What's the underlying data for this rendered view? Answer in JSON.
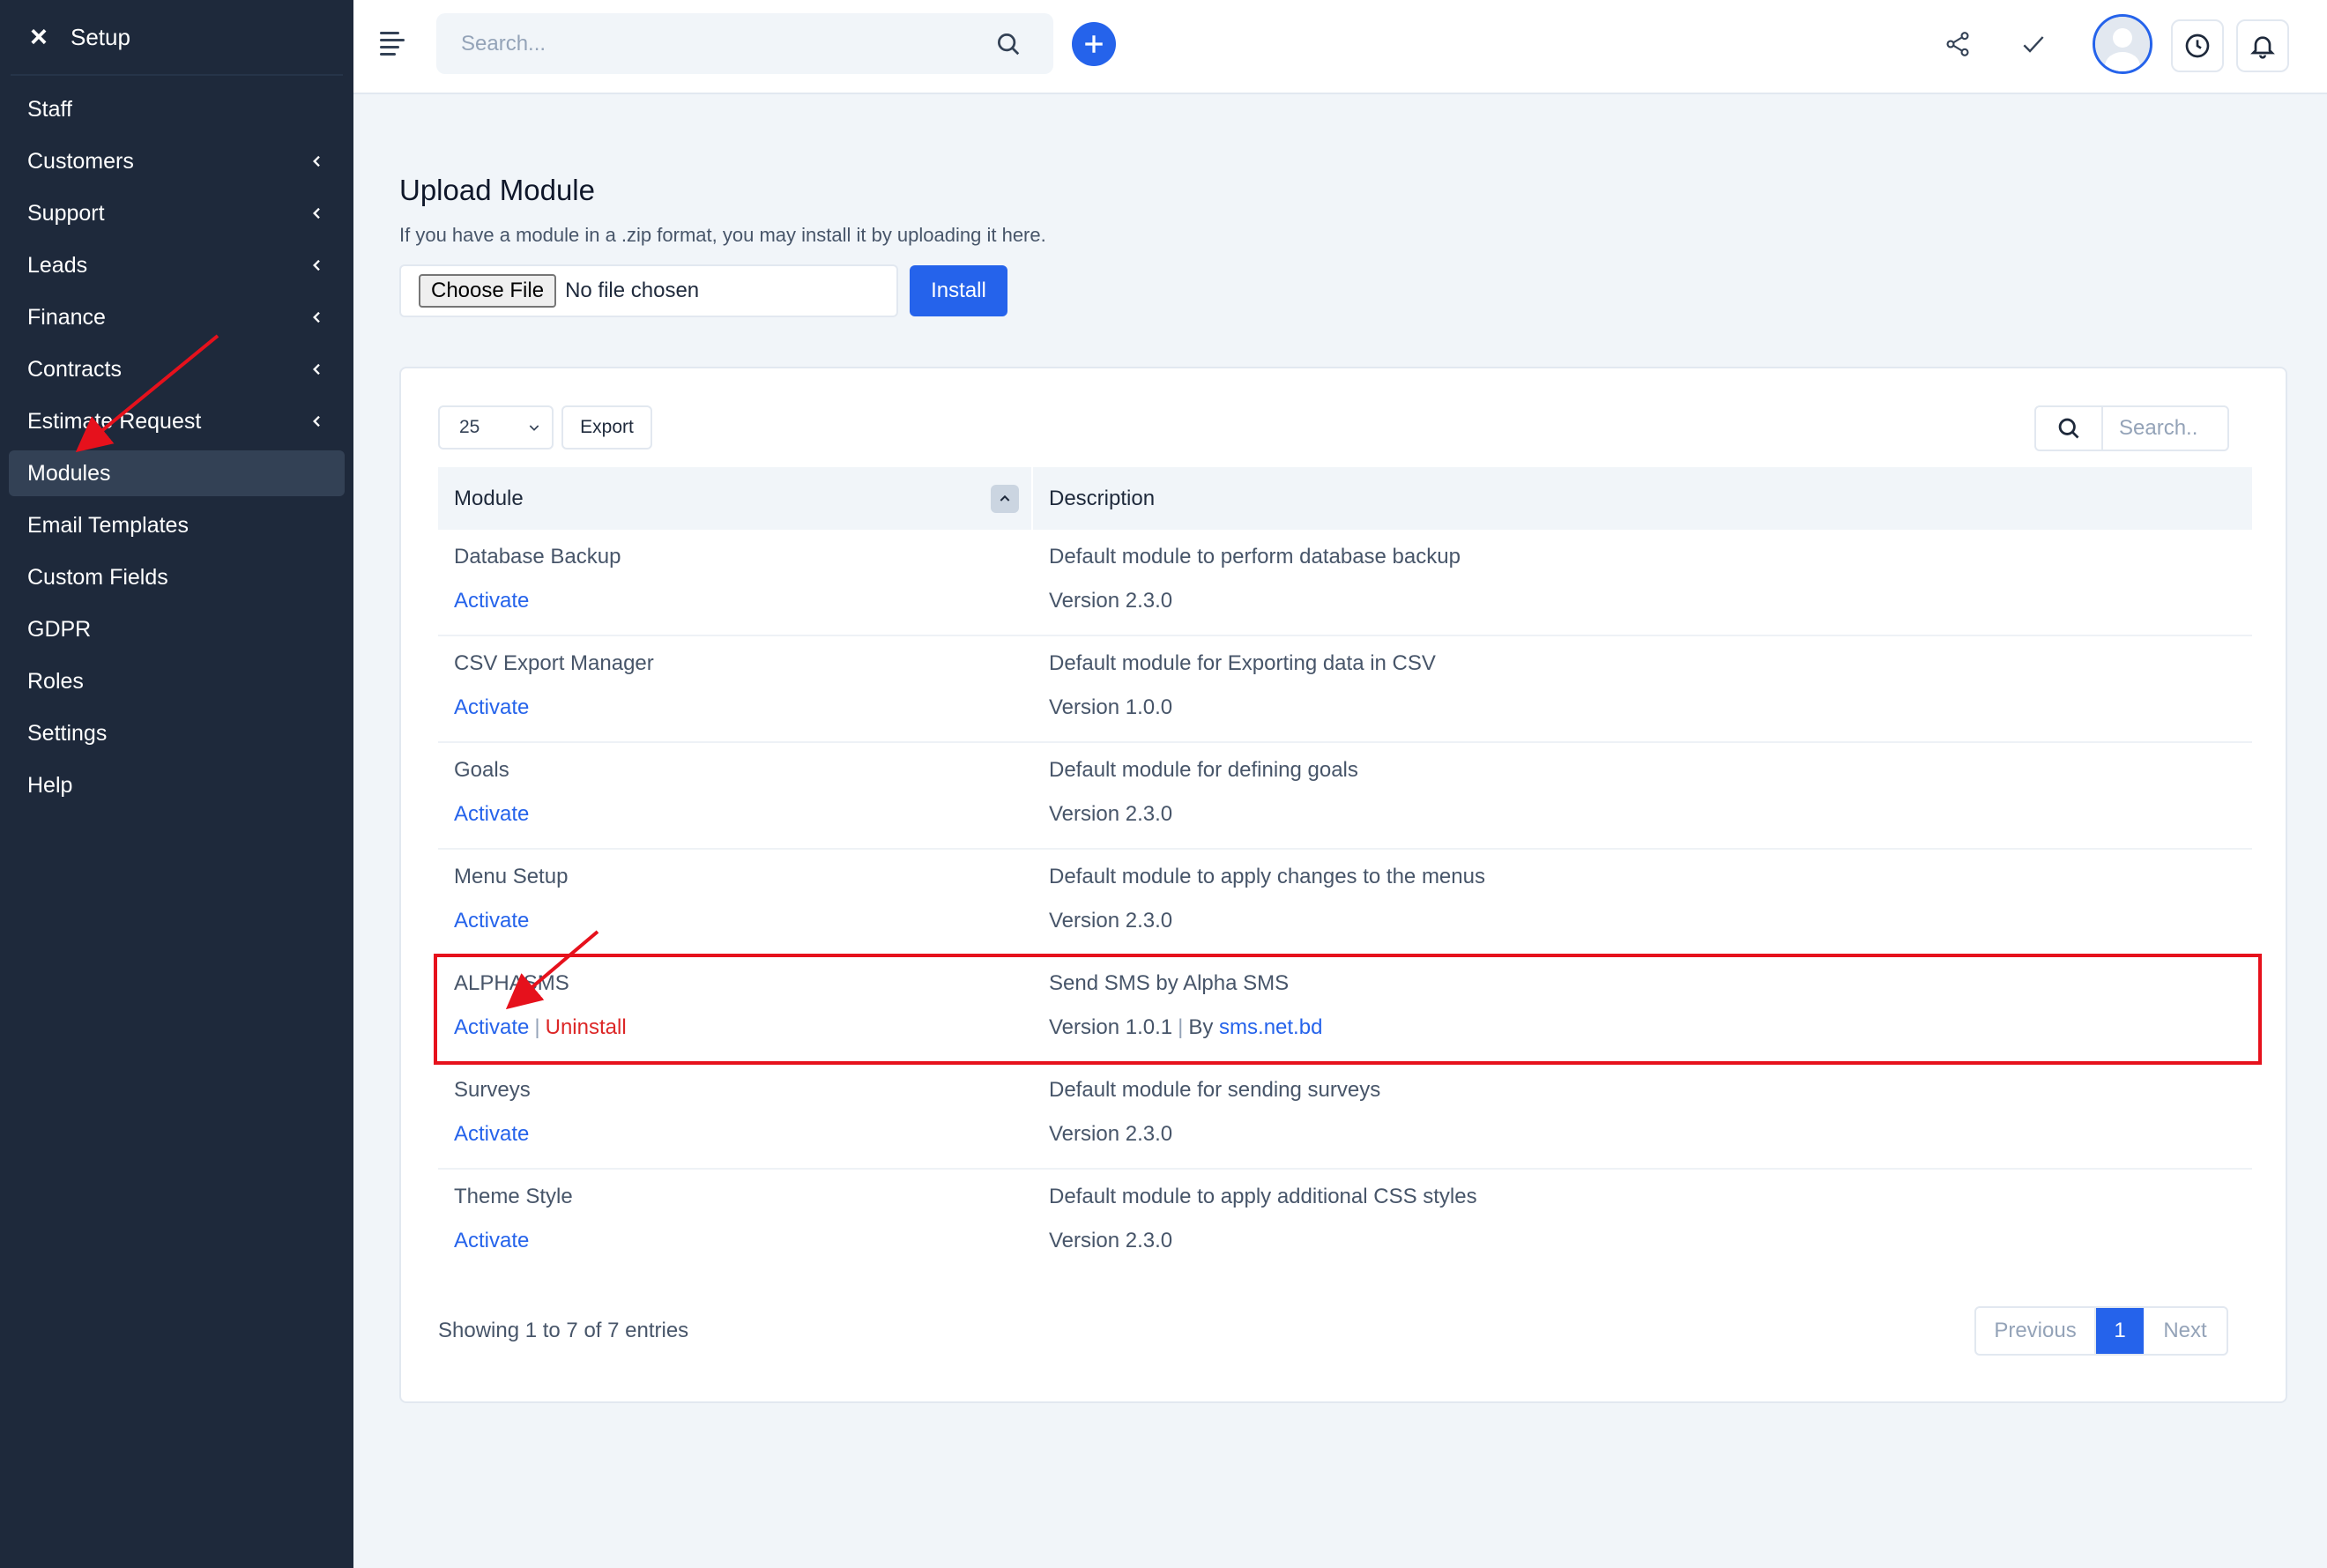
{
  "sidebar": {
    "title": "Setup",
    "items": [
      {
        "label": "Staff",
        "chevron": false,
        "active": false
      },
      {
        "label": "Customers",
        "chevron": true,
        "active": false
      },
      {
        "label": "Support",
        "chevron": true,
        "active": false
      },
      {
        "label": "Leads",
        "chevron": true,
        "active": false
      },
      {
        "label": "Finance",
        "chevron": true,
        "active": false
      },
      {
        "label": "Contracts",
        "chevron": true,
        "active": false
      },
      {
        "label": "Estimate Request",
        "chevron": true,
        "active": false
      },
      {
        "label": "Modules",
        "chevron": false,
        "active": true
      },
      {
        "label": "Email Templates",
        "chevron": false,
        "active": false
      },
      {
        "label": "Custom Fields",
        "chevron": false,
        "active": false
      },
      {
        "label": "GDPR",
        "chevron": false,
        "active": false
      },
      {
        "label": "Roles",
        "chevron": false,
        "active": false
      },
      {
        "label": "Settings",
        "chevron": false,
        "active": false
      },
      {
        "label": "Help",
        "chevron": false,
        "active": false
      }
    ]
  },
  "topbar": {
    "search_placeholder": "Search..."
  },
  "upload": {
    "title": "Upload Module",
    "description": "If you have a module in a .zip format, you may install it by uploading it here.",
    "choose_file_label": "Choose File",
    "no_file_text": "No file chosen",
    "install_label": "Install"
  },
  "table": {
    "page_length": "25",
    "export_label": "Export",
    "search_placeholder": "Search..",
    "headers": {
      "module": "Module",
      "description": "Description"
    },
    "rows": [
      {
        "name": "Database Backup",
        "activate": "Activate",
        "uninstall": "",
        "description": "Default module to perform database backup",
        "version": "Version 2.3.0",
        "by": "",
        "by_link": ""
      },
      {
        "name": "CSV Export Manager",
        "activate": "Activate",
        "uninstall": "",
        "description": "Default module for Exporting data in CSV",
        "version": "Version 1.0.0",
        "by": "",
        "by_link": ""
      },
      {
        "name": "Goals",
        "activate": "Activate",
        "uninstall": "",
        "description": "Default module for defining goals",
        "version": "Version 2.3.0",
        "by": "",
        "by_link": ""
      },
      {
        "name": "Menu Setup",
        "activate": "Activate",
        "uninstall": "",
        "description": "Default module to apply changes to the menus",
        "version": "Version 2.3.0",
        "by": "",
        "by_link": ""
      },
      {
        "name": "ALPHASMS",
        "activate": "Activate",
        "uninstall": "Uninstall",
        "description": "Send SMS by Alpha SMS",
        "version": "Version 1.0.1",
        "by": "By",
        "by_link": "sms.net.bd"
      },
      {
        "name": "Surveys",
        "activate": "Activate",
        "uninstall": "",
        "description": "Default module for sending surveys",
        "version": "Version 2.3.0",
        "by": "",
        "by_link": ""
      },
      {
        "name": "Theme Style",
        "activate": "Activate",
        "uninstall": "",
        "description": "Default module to apply additional CSS styles",
        "version": "Version 2.3.0",
        "by": "",
        "by_link": ""
      }
    ],
    "info": "Showing 1 to 7 of 7 entries",
    "pagination": {
      "previous": "Previous",
      "current": "1",
      "next": "Next"
    }
  },
  "colors": {
    "sidebar_bg": "#1e293b",
    "accent": "#2563eb",
    "danger": "#dc2626",
    "annotation": "#e6111c"
  }
}
